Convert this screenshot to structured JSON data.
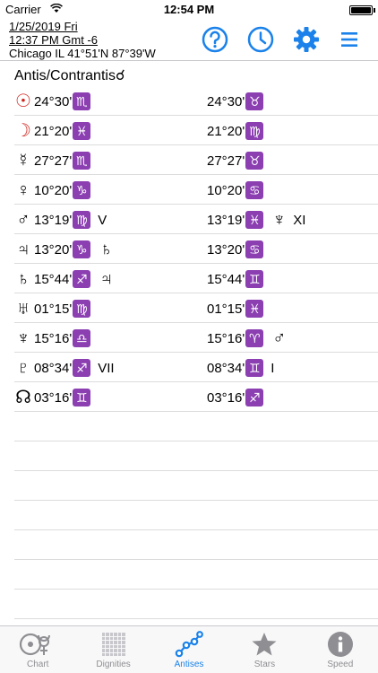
{
  "status": {
    "carrier": "Carrier",
    "time": "12:54 PM"
  },
  "header": {
    "date": "1/25/2019 Fri",
    "time_gmt": "12:37 PM Gmt -6",
    "location": "Chicago IL 41°51'N 87°39'W"
  },
  "icons": {
    "help": "question-circle-icon",
    "clock": "clock-icon",
    "settings": "gear-icon",
    "menu": "menu-icon"
  },
  "accent_color": "#1a82ea",
  "sign_color": "#8b3fb1",
  "title": "Antis/Contrantis☌",
  "rows": [
    {
      "planet": "☉",
      "left_deg": "24°30'",
      "left_sign": "♏",
      "left_extra": "",
      "left_glyph": "",
      "right_deg": "24°30'",
      "right_sign": "♉",
      "right_extra": "",
      "right_glyph": ""
    },
    {
      "planet": "☽",
      "left_deg": "21°20'",
      "left_sign": "♓",
      "left_extra": "",
      "left_glyph": "",
      "right_deg": "21°20'",
      "right_sign": "♍",
      "right_extra": "",
      "right_glyph": ""
    },
    {
      "planet": "☿",
      "left_deg": "27°27'",
      "left_sign": "♏",
      "left_extra": "",
      "left_glyph": "",
      "right_deg": "27°27'",
      "right_sign": "♉",
      "right_extra": "",
      "right_glyph": ""
    },
    {
      "planet": "♀",
      "left_deg": "10°20'",
      "left_sign": "♑",
      "left_extra": "",
      "left_glyph": "",
      "right_deg": "10°20'",
      "right_sign": "♋",
      "right_extra": "",
      "right_glyph": ""
    },
    {
      "planet": "♂",
      "left_deg": "13°19'",
      "left_sign": "♍",
      "left_extra": "V",
      "left_glyph": "",
      "right_deg": "13°19'",
      "right_sign": "♓",
      "right_extra": "XI",
      "right_glyph": "♆"
    },
    {
      "planet": "♃",
      "left_deg": "13°20'",
      "left_sign": "♑",
      "left_extra": "",
      "left_glyph": "♄",
      "right_deg": "13°20'",
      "right_sign": "♋",
      "right_extra": "",
      "right_glyph": ""
    },
    {
      "planet": "♄",
      "left_deg": "15°44'",
      "left_sign": "♐",
      "left_extra": "",
      "left_glyph": "♃",
      "right_deg": "15°44'",
      "right_sign": "♊",
      "right_extra": "",
      "right_glyph": ""
    },
    {
      "planet": "♅",
      "left_deg": "01°15'",
      "left_sign": "♍",
      "left_extra": "",
      "left_glyph": "",
      "right_deg": "01°15'",
      "right_sign": "♓",
      "right_extra": "",
      "right_glyph": ""
    },
    {
      "planet": "♆",
      "left_deg": "15°16'",
      "left_sign": "♎",
      "left_extra": "",
      "left_glyph": "",
      "right_deg": "15°16'",
      "right_sign": "♈",
      "right_extra": "",
      "right_glyph": "♂"
    },
    {
      "planet": "♇",
      "left_deg": "08°34'",
      "left_sign": "♐",
      "left_extra": "VII",
      "left_glyph": "",
      "right_deg": "08°34'",
      "right_sign": "♊",
      "right_extra": "I",
      "right_glyph": ""
    },
    {
      "planet": "☊",
      "left_deg": "03°16'",
      "left_sign": "♊",
      "left_extra": "",
      "left_glyph": "",
      "right_deg": "03°16'",
      "right_sign": "♐",
      "right_extra": "",
      "right_glyph": ""
    }
  ],
  "empty_rows": 7,
  "tabs": [
    {
      "label": "Chart",
      "icon": "chart-planets-icon",
      "active": false
    },
    {
      "label": "Dignities",
      "icon": "grid-icon",
      "active": false
    },
    {
      "label": "Antises",
      "icon": "antises-icon",
      "active": true
    },
    {
      "label": "Stars",
      "icon": "star-icon",
      "active": false
    },
    {
      "label": "Speed",
      "icon": "info-icon",
      "active": false
    }
  ]
}
